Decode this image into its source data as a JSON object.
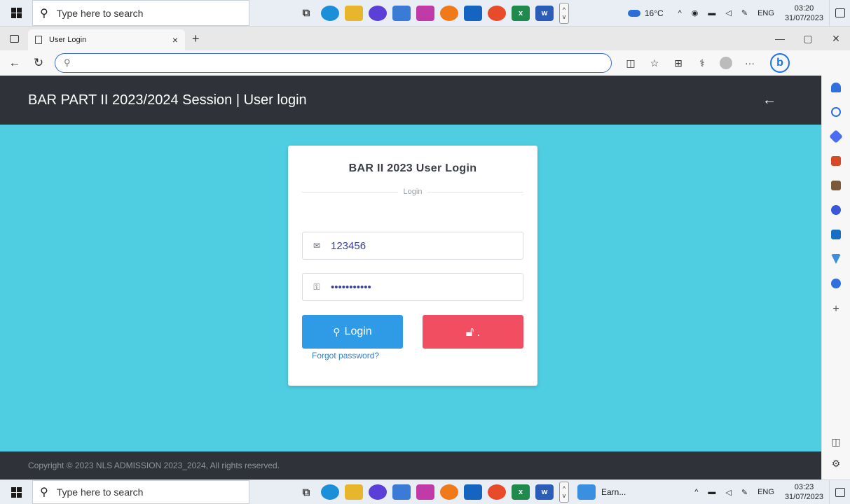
{
  "taskbar_top": {
    "search_placeholder": "Type here to search",
    "weather": "16°C",
    "lang": "ENG",
    "time": "03:20",
    "date": "31/07/2023"
  },
  "taskbar_bottom": {
    "search_placeholder": "Type here to search",
    "running_app": "Earn...",
    "lang": "ENG",
    "time": "03:23",
    "date": "31/07/2023"
  },
  "browser": {
    "tab_title": "User Login",
    "url": ""
  },
  "page": {
    "header_title": "BAR PART II 2023/2024 Session | User login",
    "footer": "Copyright © 2023 NLS ADMISSION 2023_2024, All rights reserved.",
    "card_title": "BAR II 2023 User Login",
    "divider_text": "Login",
    "username_value": "123456",
    "password_value": "•••••••••••",
    "login_label": "Login",
    "reset_label": ".",
    "forgot_label": "Forgot password?"
  },
  "colors": {
    "page_bg": "#4fcde1",
    "header_bg": "#2f3339",
    "login_btn": "#2f9be6",
    "reset_btn": "#f24e62"
  }
}
